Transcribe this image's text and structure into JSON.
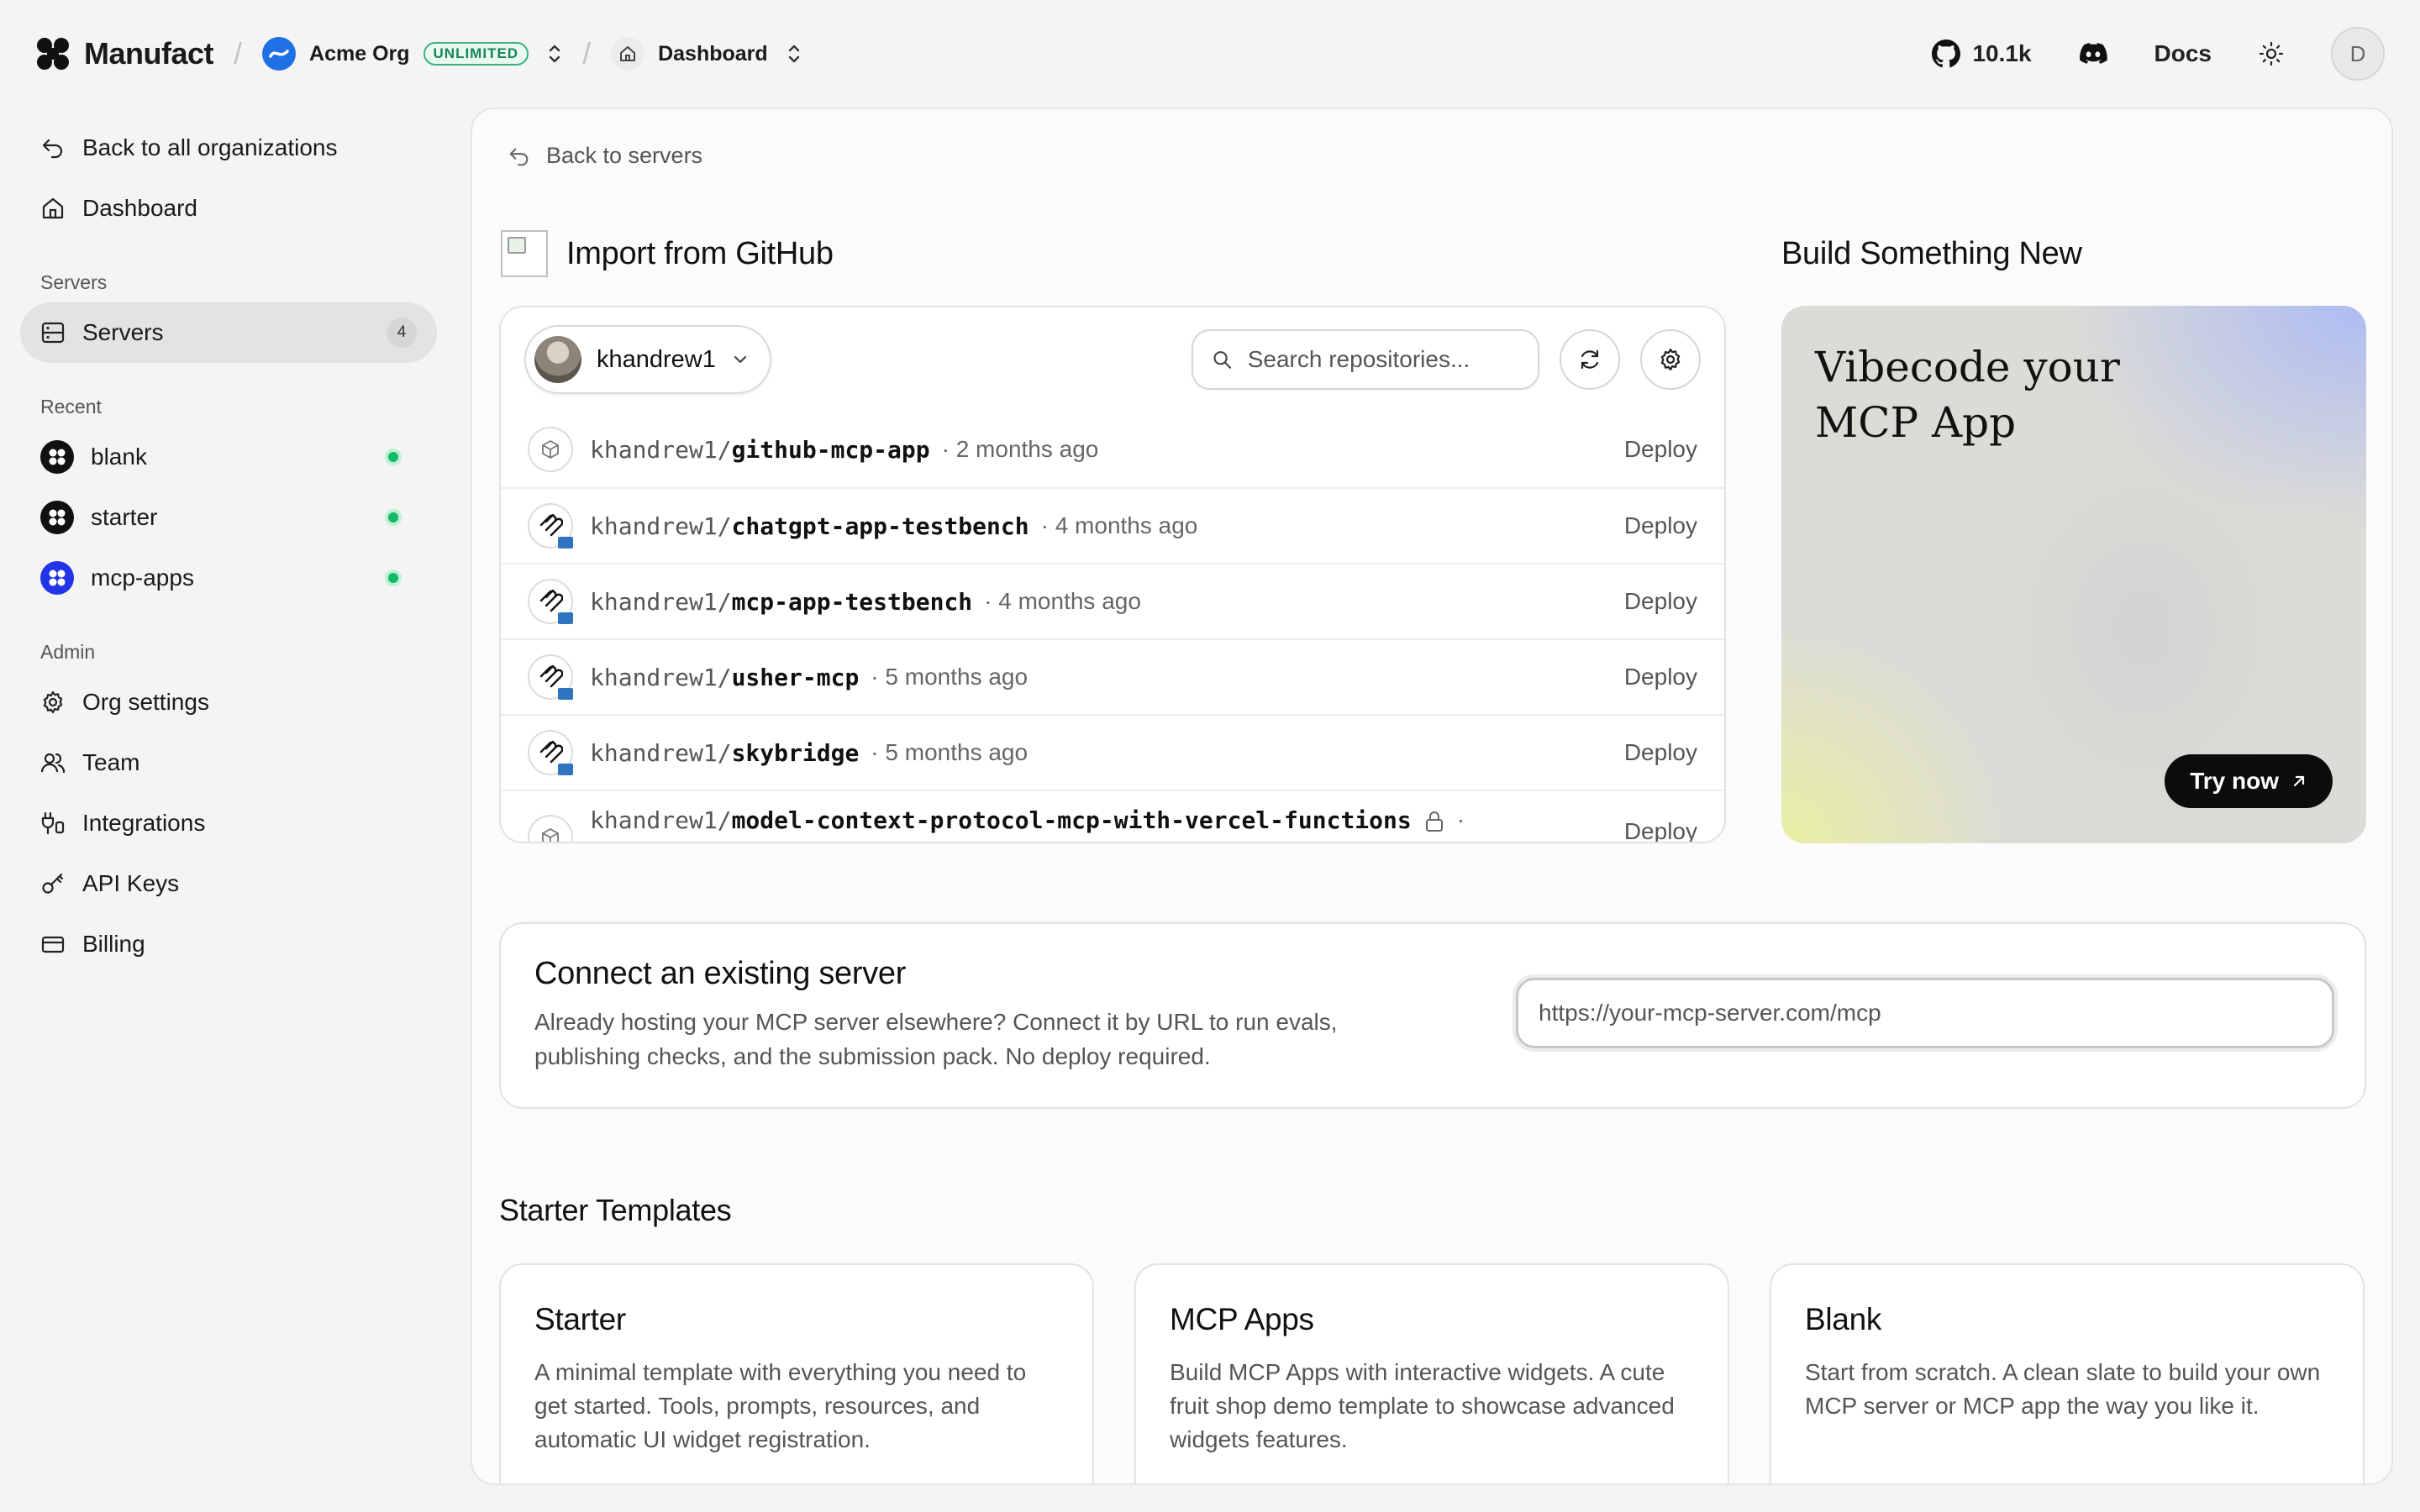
{
  "topbar": {
    "brand": "Manufact",
    "org_name": "Acme Org",
    "org_badge": "UNLIMITED",
    "page_crumb": "Dashboard",
    "github_stars": "10.1k",
    "docs_label": "Docs",
    "avatar_initial": "D"
  },
  "sidebar": {
    "back_label": "Back to all organizations",
    "dashboard_label": "Dashboard",
    "servers_section": "Servers",
    "servers_label": "Servers",
    "servers_count": "4",
    "recent_section": "Recent",
    "recent": [
      {
        "name": "blank"
      },
      {
        "name": "starter"
      },
      {
        "name": "mcp-apps"
      }
    ],
    "admin_section": "Admin",
    "admin": [
      {
        "label": "Org settings"
      },
      {
        "label": "Team"
      },
      {
        "label": "Integrations"
      },
      {
        "label": "API Keys"
      },
      {
        "label": "Billing"
      }
    ]
  },
  "main": {
    "back_label": "Back to servers",
    "import_title": "Import from GitHub",
    "owner": "khandrew1",
    "search_placeholder": "Search repositories...",
    "repos": [
      {
        "owner": "khandrew1/",
        "name": "github-mcp-app",
        "meta": "· 2 months ago",
        "action": "Deploy"
      },
      {
        "owner": "khandrew1/",
        "name": "chatgpt-app-testbench",
        "meta": "· 4 months ago",
        "action": "Deploy"
      },
      {
        "owner": "khandrew1/",
        "name": "mcp-app-testbench",
        "meta": "· 4 months ago",
        "action": "Deploy"
      },
      {
        "owner": "khandrew1/",
        "name": "usher-mcp",
        "meta": "· 5 months ago",
        "action": "Deploy"
      },
      {
        "owner": "khandrew1/",
        "name": "skybridge",
        "meta": "· 5 months ago",
        "action": "Deploy"
      },
      {
        "owner": "khandrew1/",
        "name": "model-context-protocol-mcp-with-vercel-functions",
        "meta": "·",
        "action": "Deploy"
      }
    ],
    "build_title": "Build Something New",
    "promo_line1": "Vibecode your",
    "promo_line2": "MCP App",
    "try_label": "Try now",
    "connect_title": "Connect an existing server",
    "connect_desc": "Already hosting your MCP server elsewhere? Connect it by URL to run evals, publishing checks, and the submission pack. No deploy required.",
    "url_placeholder": "https://your-mcp-server.com/mcp",
    "templates_title": "Starter Templates",
    "templates": [
      {
        "name": "Starter",
        "desc": "A minimal template with everything you need to get started. Tools, prompts, resources, and automatic UI widget registration."
      },
      {
        "name": "MCP Apps",
        "desc": "Build MCP Apps with interactive widgets. A cute fruit shop demo template to showcase advanced widgets features."
      },
      {
        "name": "Blank",
        "desc": "Start from scratch. A clean slate to build your own MCP server or MCP app the way you like it."
      }
    ]
  },
  "colors": {
    "accent_green": "#14b86a",
    "org_blue": "#1f6fe5",
    "mcp_apps_blue": "#2234e6"
  }
}
